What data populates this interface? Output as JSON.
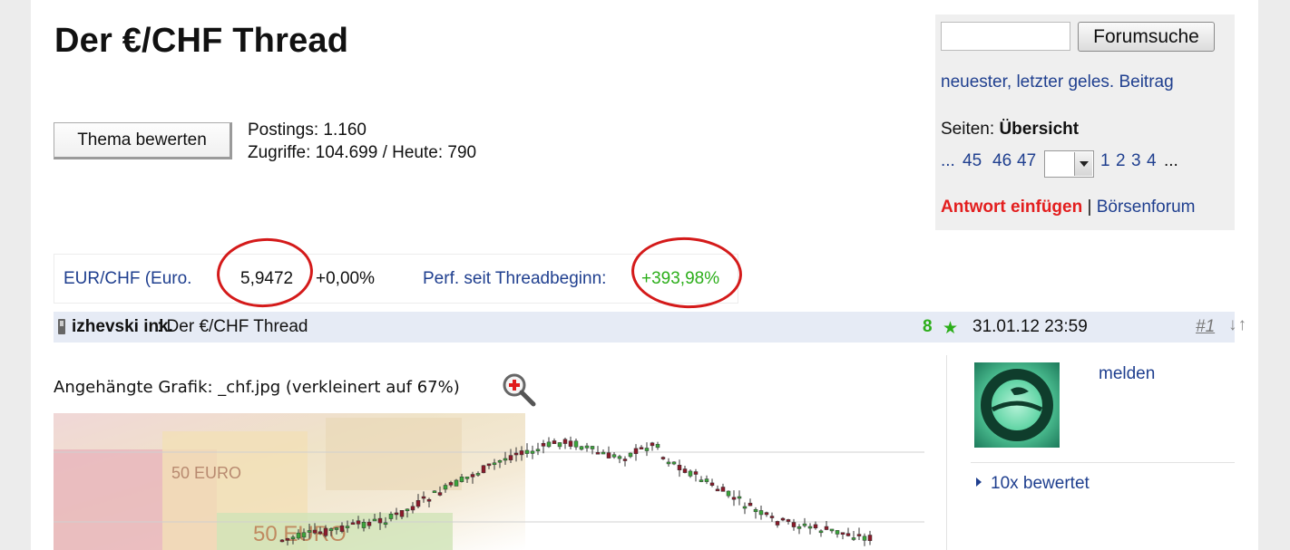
{
  "thread": {
    "title": "Der €/CHF Thread",
    "rate_button": "Thema bewerten",
    "postings": "Postings: 1.160",
    "views": "Zugriffe: 104.699 / Heute: 790"
  },
  "sidebar": {
    "search_placeholder": "",
    "search_button": "Forumsuche",
    "newest_link": "neuester, letzter geles. Beitrag",
    "pages_label": "Seiten: ",
    "pages_overview": "Übersicht",
    "pages": [
      "...",
      "45",
      "46",
      "47",
      "1",
      "2",
      "3",
      "4",
      "..."
    ],
    "answer_link": "Antwort einfügen",
    "separator": "|",
    "forum_link": "Börsenforum"
  },
  "quote": {
    "name": "EUR/CHF (Euro.",
    "price": "5,9472",
    "change": "+0,00%",
    "perf_label": "Perf. seit Threadbeginn:",
    "perf_value": "+393,98%",
    "annotation_color": "#d41a1a"
  },
  "post": {
    "author": "izhevski ink.",
    "title_sep": ": Der €/CHF Thread",
    "rating_count": "8",
    "date": "31.01.12 23:59",
    "number": "#1",
    "arrows": "↓↑",
    "attachment": "Angehängte Grafik: _chf.jpg (verkleinert auf 67%)",
    "report_link": "melden",
    "rated": "10x bewertet"
  },
  "colors": {
    "link": "#1f3f8f",
    "positive": "#2cae1a",
    "answer": "#e31e1e",
    "header_bg": "#e6ebf5"
  }
}
